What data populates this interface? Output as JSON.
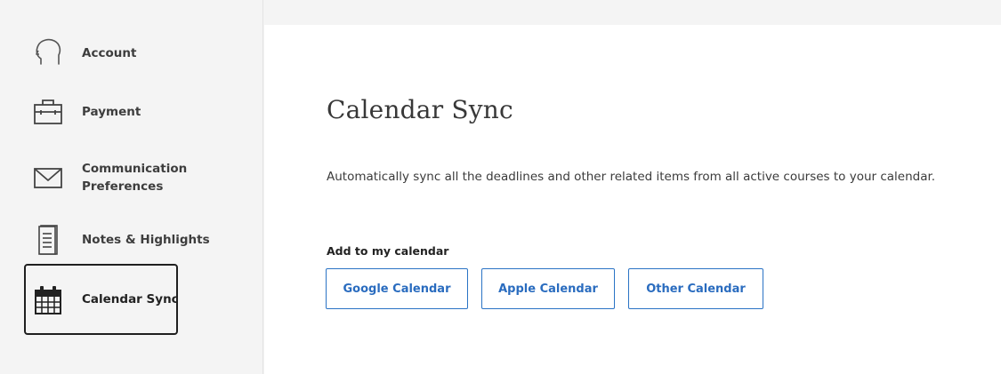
{
  "sidebar": {
    "items": [
      {
        "label": "Account",
        "icon": "head-outline-icon"
      },
      {
        "label": "Payment",
        "icon": "briefcase-icon"
      },
      {
        "label": "Communication Preferences",
        "label_line1": "Communication",
        "label_line2": "Preferences",
        "icon": "envelope-icon"
      },
      {
        "label": "Notes & Highlights",
        "icon": "notes-icon"
      },
      {
        "label": "Calendar Sync",
        "icon": "calendar-icon",
        "selected": true
      }
    ]
  },
  "main": {
    "title": "Calendar Sync",
    "description": "Automatically sync all the deadlines and other related items from all active courses to your calendar.",
    "add_label": "Add to my calendar",
    "buttons": {
      "google": "Google Calendar",
      "apple": "Apple Calendar",
      "other": "Other Calendar"
    }
  },
  "colors": {
    "background": "#f4f4f4",
    "panel": "#ffffff",
    "accent": "#2a6cbf",
    "text": "#3b3b3b",
    "selected_border": "#1f1f1f"
  }
}
